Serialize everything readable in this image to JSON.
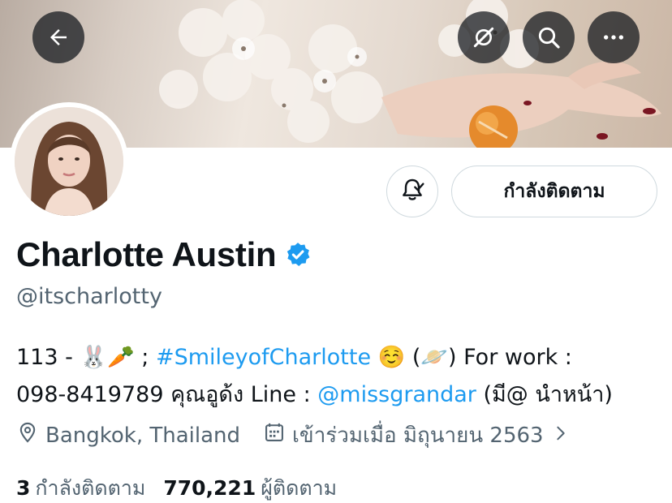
{
  "header": {
    "back_icon": "arrow-left-icon",
    "mute_icon": "eye-slash-icon",
    "search_icon": "search-icon",
    "more_icon": "more-horizontal-icon"
  },
  "profile": {
    "display_name": "Charlotte Austin",
    "handle": "@itscharlotty",
    "verified": true,
    "verified_color": "#1d9bf0"
  },
  "actions": {
    "notify_icon": "bell-check-icon",
    "following_label": "กำลังติดตาม"
  },
  "bio": {
    "line1_prefix": "113 - 🐰🥕 ; ",
    "hashtag": "#SmileyofCharlotte",
    "line1_suffix": " ☺️ (🪐) For work :",
    "line2_prefix": "098-8419789 คุณอูด้ง Line : ",
    "mention": "@missgrandar",
    "line2_suffix": " (มี@ นำหน้า)"
  },
  "meta": {
    "location": "Bangkok, Thailand",
    "joined": "เข้าร่วมเมื่อ มิถุนายน 2563"
  },
  "stats": {
    "following_count": "3",
    "following_label": "กำลังติดตาม",
    "followers_count": "770,221",
    "followers_label": "ผู้ติดตาม"
  },
  "colors": {
    "accent": "#1d9bf0",
    "secondary_text": "#536471",
    "primary_text": "#0f1419"
  }
}
